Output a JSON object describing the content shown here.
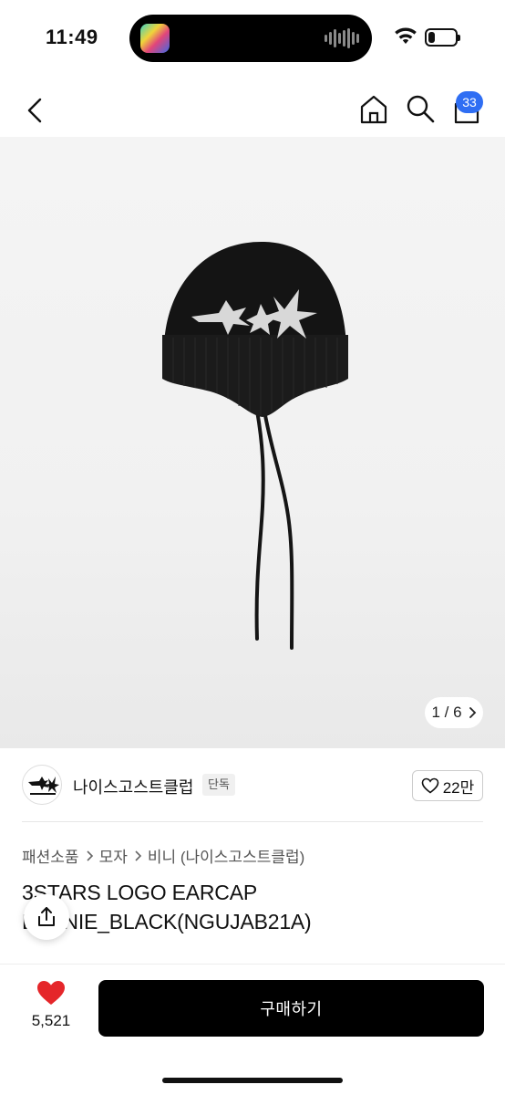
{
  "status_bar": {
    "time": "11:49",
    "battery_level": 0.25
  },
  "nav": {
    "back_icon": "chevron-left-icon",
    "home_icon": "home-icon",
    "search_icon": "search-icon",
    "cart_icon": "cart-icon",
    "cart_count": "33",
    "badge_color": "#2f6ef3"
  },
  "gallery": {
    "counter": "1 / 6"
  },
  "brand": {
    "name": "나이스고스트클럽",
    "tag": "단독",
    "likes": "22만"
  },
  "breadcrumb": [
    "패션소품",
    "모자",
    "비니 (나이스고스트클럽)"
  ],
  "product": {
    "title": "3STARS LOGO EARCAP BEANIE_BLACK(NGUJAB21A)"
  },
  "bottom_bar": {
    "wish_count": "5,521",
    "buy_label": "구매하기",
    "heart_color": "#e5262a"
  }
}
